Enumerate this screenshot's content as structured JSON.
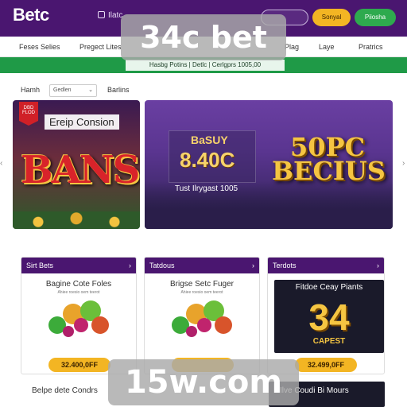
{
  "header": {
    "logo": "Betc",
    "link": "Ilatc",
    "btn_login": "Sonyal",
    "btn_register": "Piiosha"
  },
  "nav": {
    "items": [
      "Feses Selies",
      "Pregect Lites",
      "Plag",
      "Laye",
      "Pratrics"
    ]
  },
  "promo": {
    "text": "Hasbg Potins | Detlc | Cerlgprs 1005,00"
  },
  "filters": {
    "label": "Hamh",
    "select_value": "Gedlen",
    "right_label": "Barlins"
  },
  "hero_left": {
    "badge": "DBD FLOD",
    "title": "Ereip Consion",
    "big_text": "BANS"
  },
  "hero_right": {
    "small": "BaSUY",
    "amount": "8.40C",
    "sub": "Tust Ilrygast 1005",
    "bonus_line1": "50PC",
    "bonus_line2": "BECIUS"
  },
  "cards": [
    {
      "header": "Sirt Bets",
      "title": "Bagine Cote Foles",
      "sub": "Ahiee roesio oem teerot",
      "button": "32.400,0FF"
    },
    {
      "header": "Tatdous",
      "title": "Brigse Setc Fuger",
      "sub": "Ahiee roesio oem teerot",
      "button": ""
    },
    {
      "header": "Terdots",
      "title": "Fitdoe Ceay Piants",
      "number": "34",
      "number_sub": "CAPEST",
      "button": "32.499,0FF"
    }
  ],
  "bottom": {
    "left": "Belpe dete Condrs",
    "right": "Ilve Coudi Bi Mours"
  },
  "watermarks": {
    "top": "34c bet",
    "bottom": "15w.com"
  },
  "colors": {
    "header_purple": "#4a1670",
    "accent_yellow": "#f3b523",
    "accent_green": "#2eaa4e",
    "promo_green": "#1f9a47"
  }
}
